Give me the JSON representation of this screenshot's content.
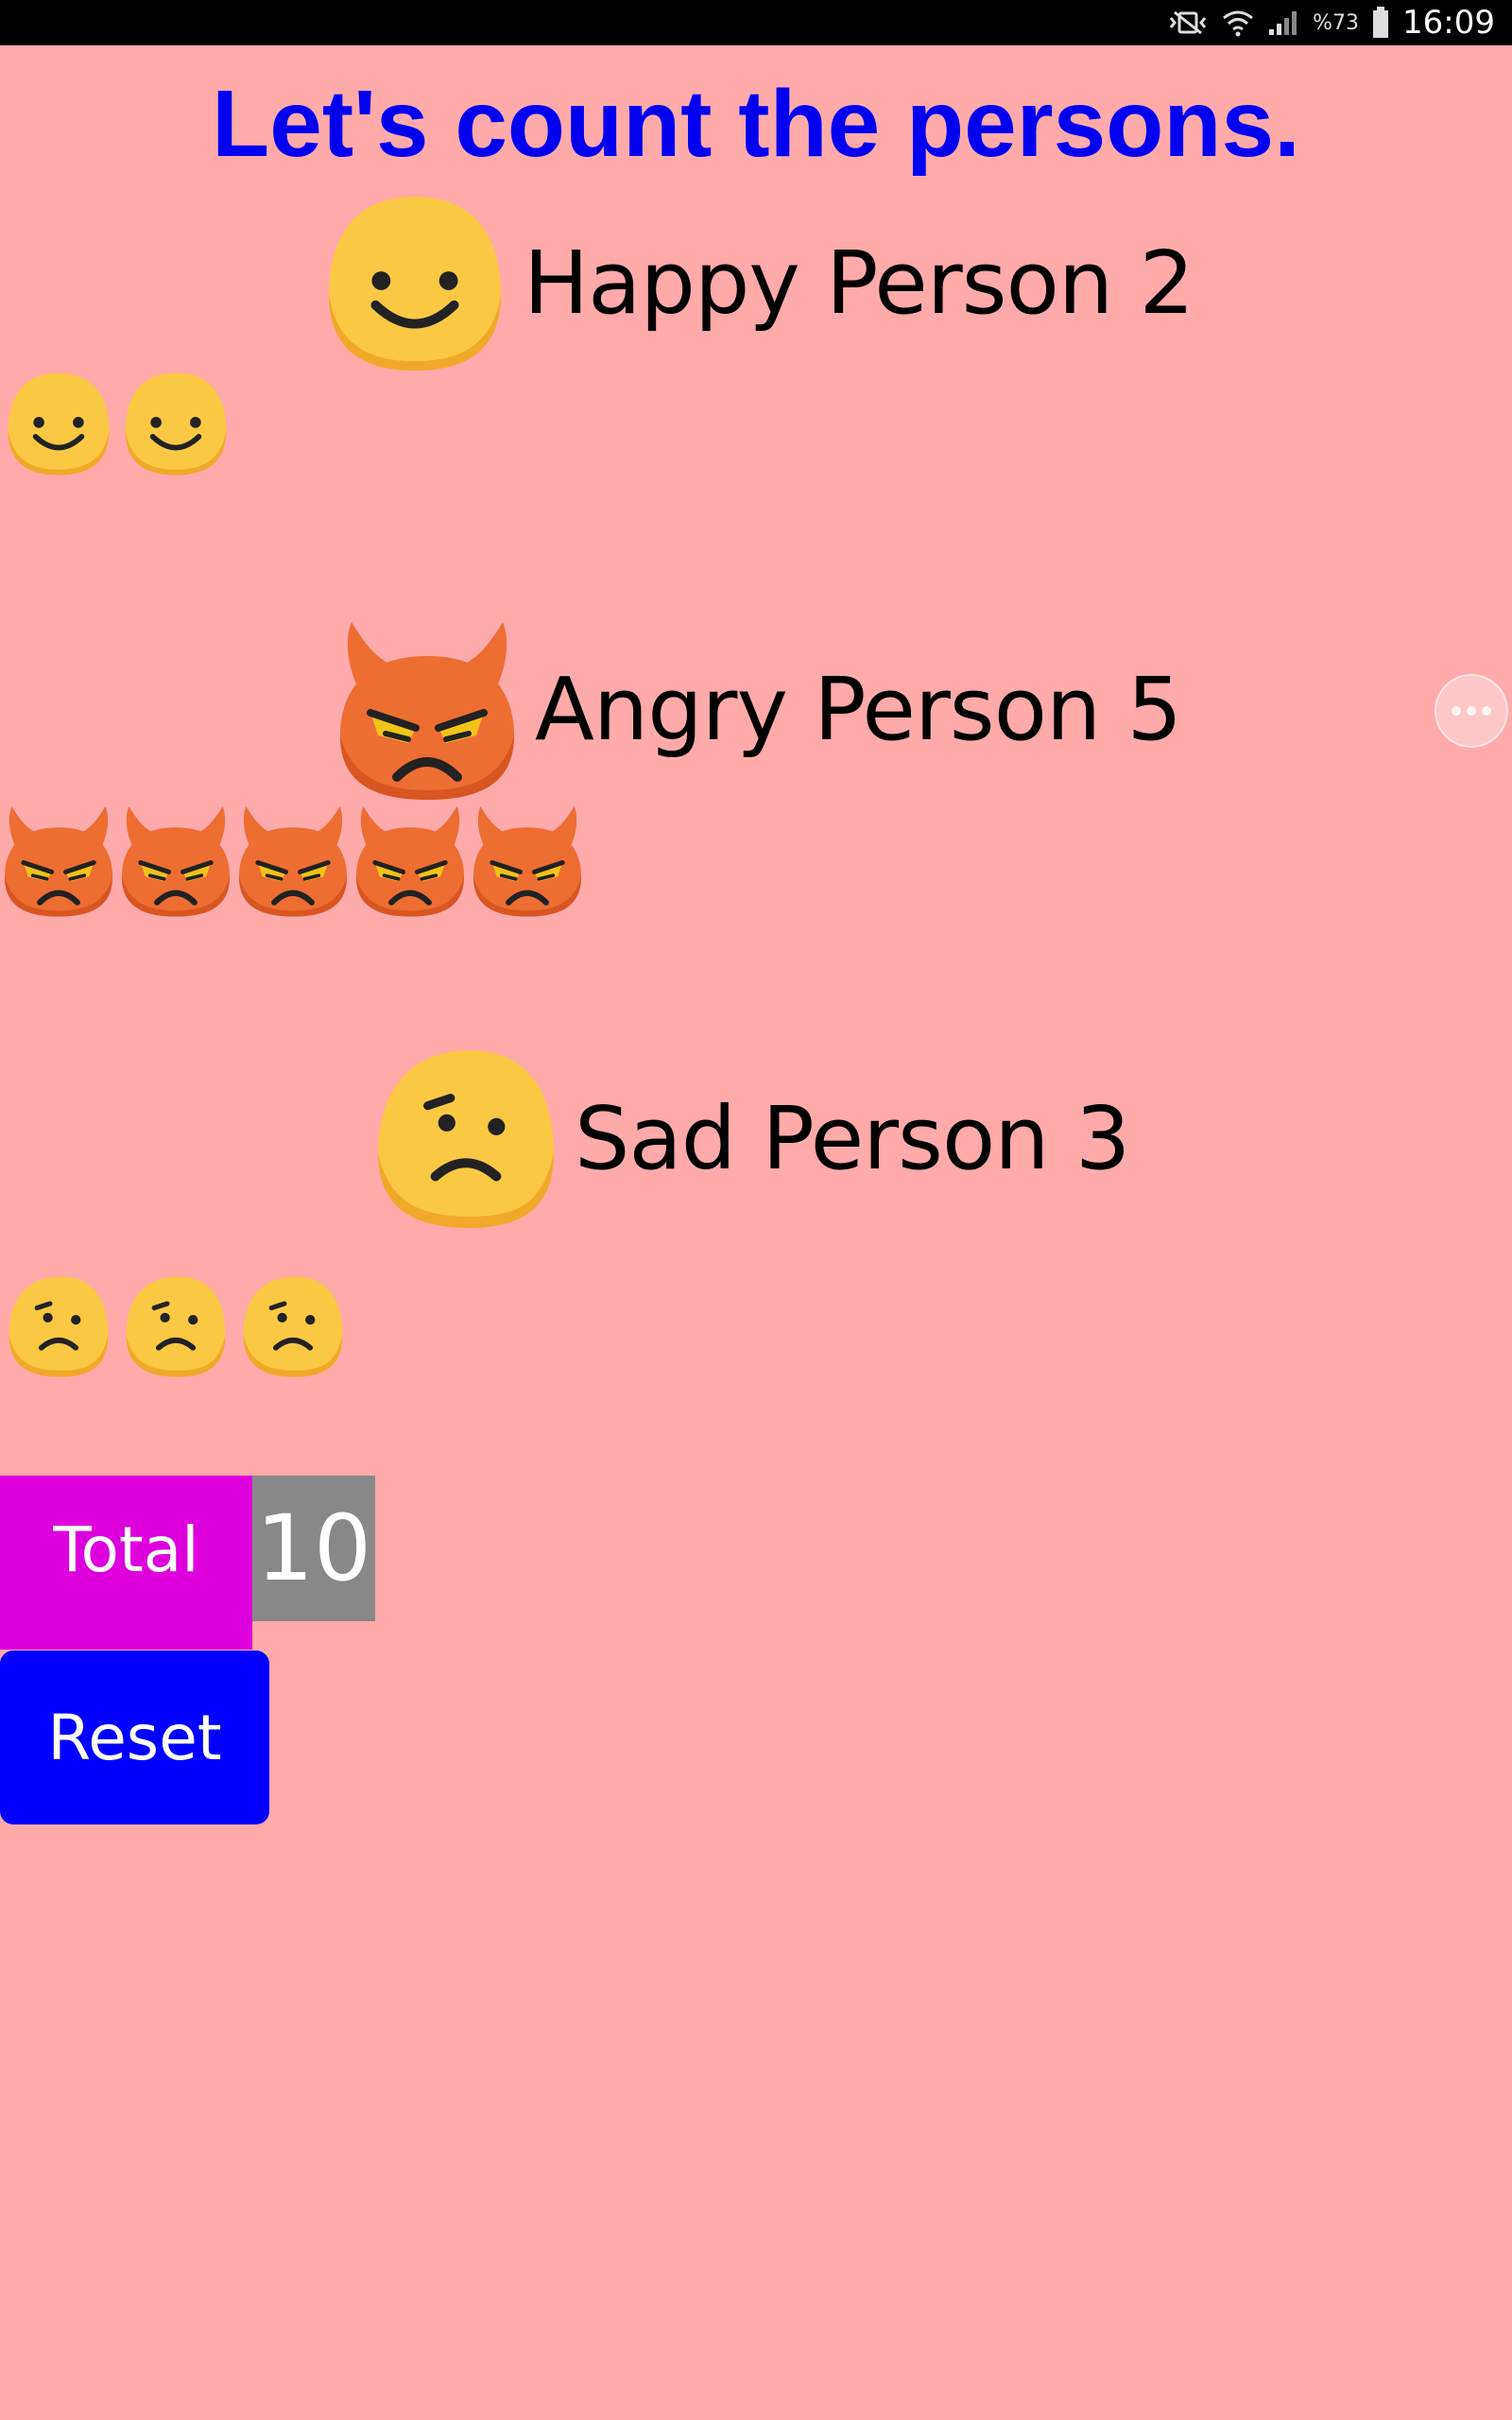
{
  "status_bar": {
    "battery_percent": "%73",
    "time": "16:09"
  },
  "app": {
    "title": "Let's count the persons."
  },
  "sections": [
    {
      "icon": "happy-face-icon",
      "label": "Happy Person 2",
      "count": 2
    },
    {
      "icon": "angry-devil-icon",
      "label": "Angry Person 5",
      "count": 5
    },
    {
      "icon": "sad-face-icon",
      "label": "Sad Person 3",
      "count": 3
    }
  ],
  "total": {
    "label": "Total",
    "value": "10"
  },
  "reset": {
    "label": "Reset"
  },
  "colors": {
    "background": "#ffaaab",
    "title": "#0000ee",
    "total_label_bg": "#dd00dd",
    "total_value_bg": "#888888",
    "reset_bg": "#0000ff",
    "emoji_yellow": "#fbc843",
    "emoji_orange": "#ee6d32"
  }
}
